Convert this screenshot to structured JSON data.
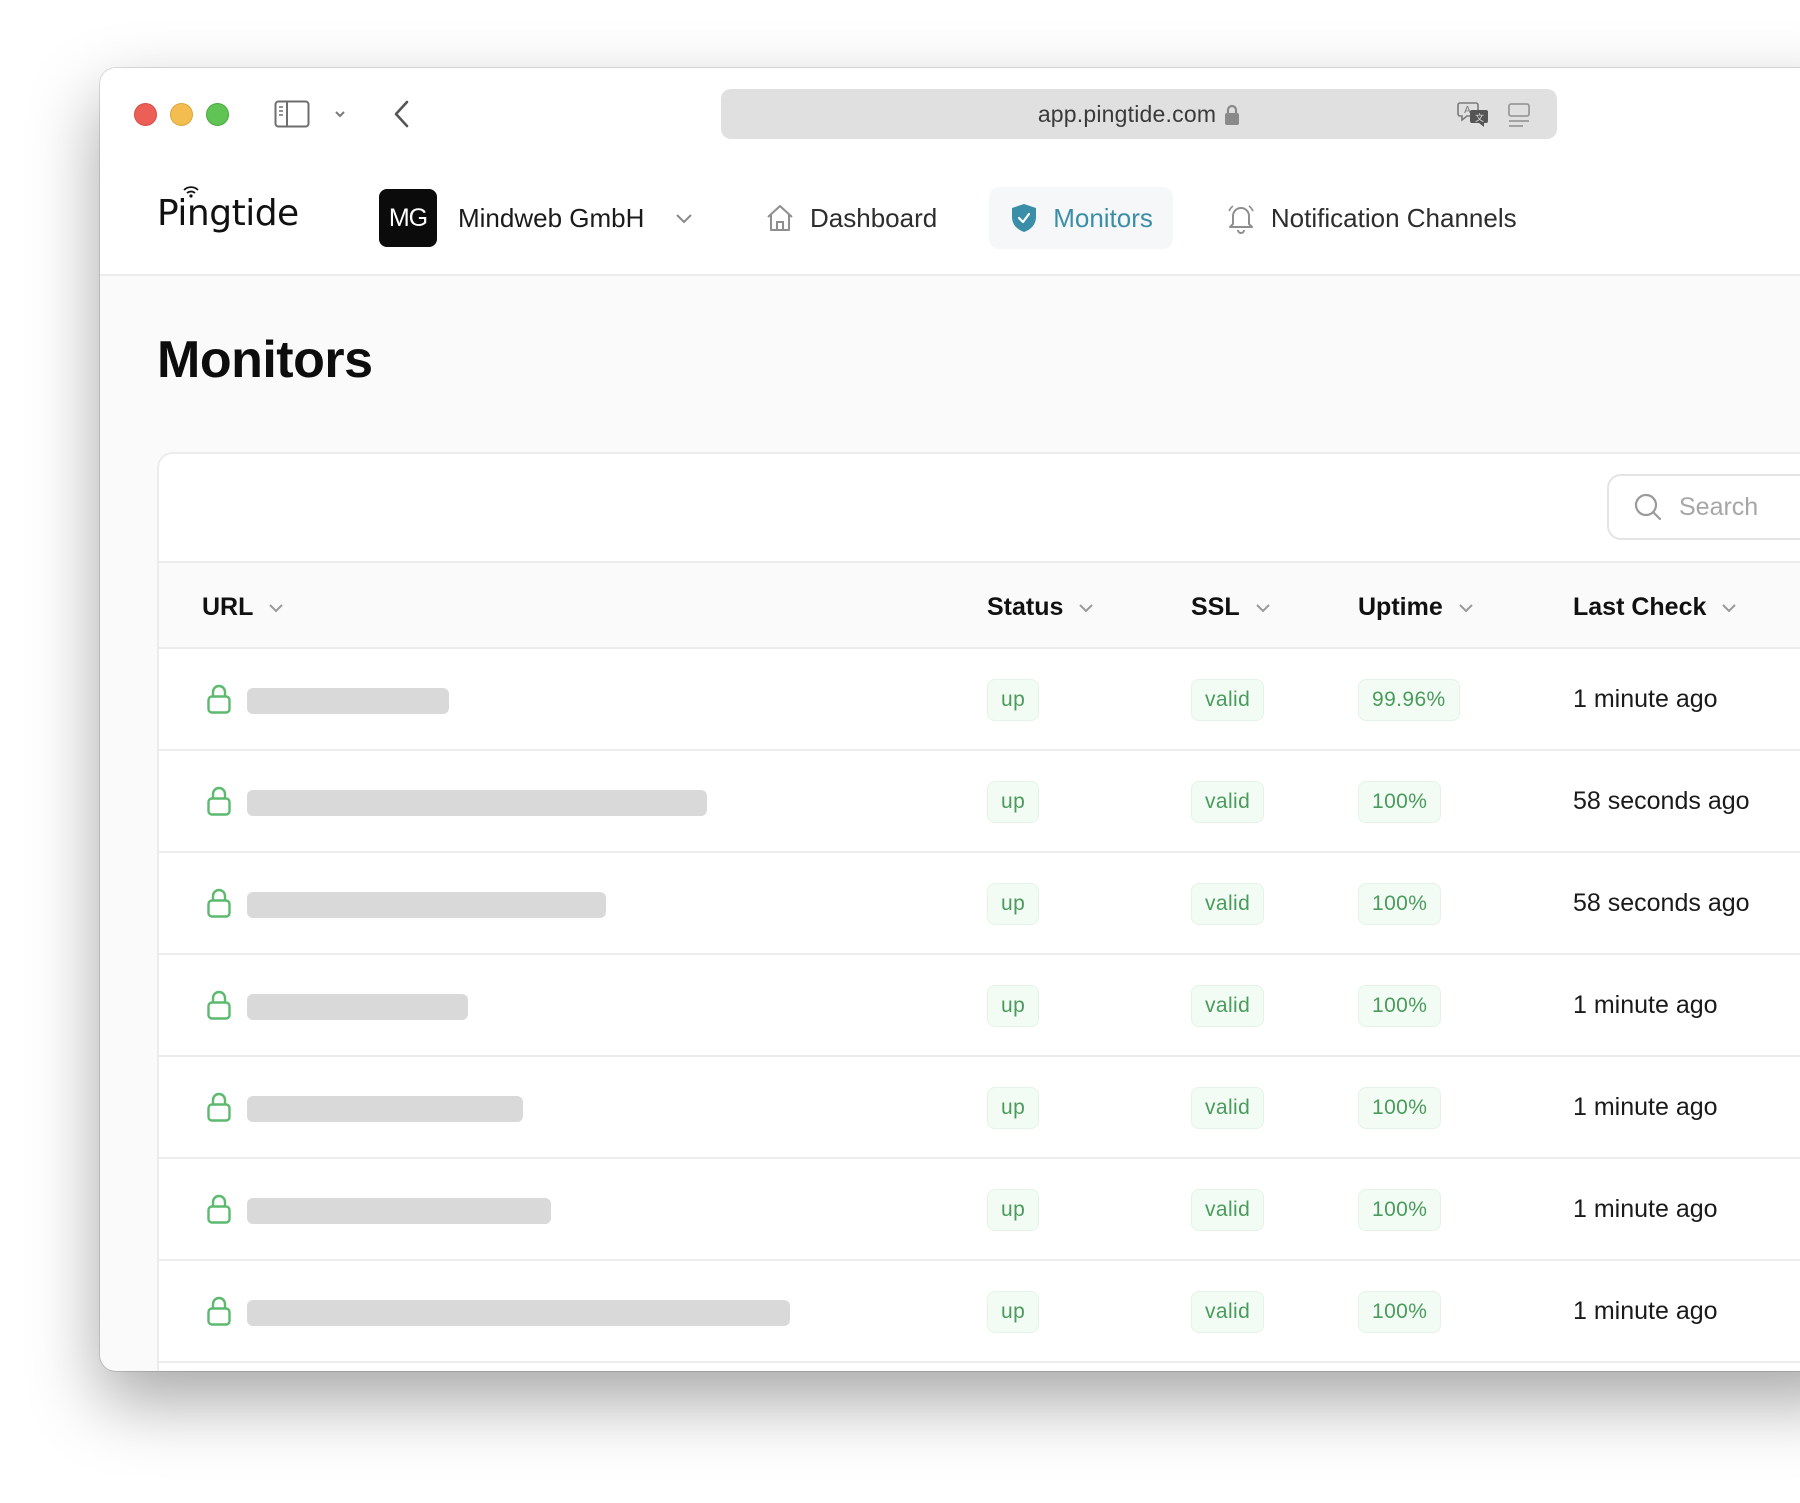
{
  "browser": {
    "url": "app.pingtide.com",
    "icons": [
      "sidebar-toggle-icon",
      "chevron-down-icon",
      "back-arrow-icon",
      "lock-icon",
      "translate-icon",
      "reader-icon"
    ]
  },
  "header": {
    "logo": "Pingtide",
    "org": {
      "initials": "MG",
      "name": "Mindweb GmbH"
    },
    "nav": [
      {
        "label": "Dashboard",
        "icon": "home-icon",
        "active": false
      },
      {
        "label": "Monitors",
        "icon": "shield-check-icon",
        "active": true
      },
      {
        "label": "Notification Channels",
        "icon": "bell-icon",
        "active": false
      }
    ],
    "accent_color": "#3b8ea7"
  },
  "page": {
    "title": "Monitors",
    "search": {
      "placeholder": "Search",
      "value": ""
    }
  },
  "table": {
    "columns": [
      "URL",
      "Status",
      "SSL",
      "Uptime",
      "Last Check"
    ],
    "rows": [
      {
        "url": "[redacted]",
        "url_mask_fraction": 0.22,
        "status": "up",
        "ssl": "valid",
        "uptime": "99.96%",
        "last_check": "1 minute ago"
      },
      {
        "url": "[redacted]",
        "url_mask_fraction": 0.5,
        "status": "up",
        "ssl": "valid",
        "uptime": "100%",
        "last_check": "58 seconds ago"
      },
      {
        "url": "[redacted]",
        "url_mask_fraction": 0.39,
        "status": "up",
        "ssl": "valid",
        "uptime": "100%",
        "last_check": "58 seconds ago"
      },
      {
        "url": "[redacted]",
        "url_mask_fraction": 0.24,
        "status": "up",
        "ssl": "valid",
        "uptime": "100%",
        "last_check": "1 minute ago"
      },
      {
        "url": "[redacted]",
        "url_mask_fraction": 0.3,
        "status": "up",
        "ssl": "valid",
        "uptime": "100%",
        "last_check": "1 minute ago"
      },
      {
        "url": "[redacted]",
        "url_mask_fraction": 0.33,
        "status": "up",
        "ssl": "valid",
        "uptime": "100%",
        "last_check": "1 minute ago"
      },
      {
        "url": "[redacted]",
        "url_mask_fraction": 0.59,
        "status": "up",
        "ssl": "valid",
        "uptime": "100%",
        "last_check": "1 minute ago"
      }
    ],
    "status_color": "#4a9b5c"
  }
}
